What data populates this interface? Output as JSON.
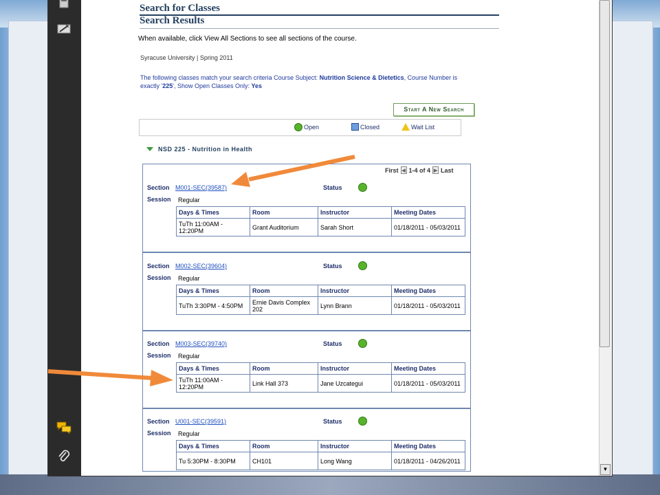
{
  "page": {
    "title": "Search for Classes",
    "subtitle": "Search Results",
    "instruction": "When available, click View All Sections to see all sections of the course.",
    "institution": "Syracuse University | Spring 2011",
    "criteria_prefix": "The following classes match your search criteria Course Subject: ",
    "criteria_subject": "Nutrition Science & Dietetics",
    "criteria_mid1": ",  Course Number is exactly '",
    "criteria_number": "225",
    "criteria_mid2": "',  Show Open Classes Only: ",
    "criteria_open": "Yes",
    "new_search_label": "Start A New Search"
  },
  "legend": {
    "open": "Open",
    "closed": "Closed",
    "waitlist": "Wait List"
  },
  "course": {
    "title": "NSD 225 - Nutrition in Health",
    "pager": {
      "first": "First",
      "range": "1-4 of 4",
      "last": "Last"
    }
  },
  "labels": {
    "section": "Section",
    "status": "Status",
    "session": "Session",
    "col_days": "Days & Times",
    "col_room": "Room",
    "col_instructor": "Instructor",
    "col_dates": "Meeting Dates"
  },
  "sections": [
    {
      "id": "M001-SEC(39587)",
      "session": "Regular",
      "status": "open",
      "days_times": "TuTh 11:00AM - 12:20PM",
      "room": "Grant Auditorium",
      "instructor": "Sarah Short",
      "dates": "01/18/2011 - 05/03/2011"
    },
    {
      "id": "M002-SEC(39604)",
      "session": "Regular",
      "status": "open",
      "days_times": "TuTh 3:30PM - 4:50PM",
      "room": "Ernie Davis Complex 202",
      "instructor": "Lynn Brann",
      "dates": "01/18/2011 - 05/03/2011"
    },
    {
      "id": "M003-SEC(39740)",
      "session": "Regular",
      "status": "open",
      "days_times": "TuTh 11:00AM - 12:20PM",
      "room": "Link Hall 373",
      "instructor": "Jane Uzcategui",
      "dates": "01/18/2011 - 05/03/2011"
    },
    {
      "id": "U001-SEC(39591)",
      "session": "Regular",
      "status": "open",
      "days_times": "Tu 5:30PM - 8:30PM",
      "room": "CH101",
      "instructor": "Long Wang",
      "dates": "01/18/2011 - 04/26/2011"
    }
  ],
  "colors": {
    "open": "#58b32b",
    "heading": "#23405f",
    "link": "#1f4fbf",
    "arrow": "#f08a3a",
    "accent": "#6e86ae"
  },
  "icons": {
    "pages": "pages-icon",
    "sign": "sign-icon",
    "comments": "comments-icon",
    "attach": "paperclip-icon"
  }
}
